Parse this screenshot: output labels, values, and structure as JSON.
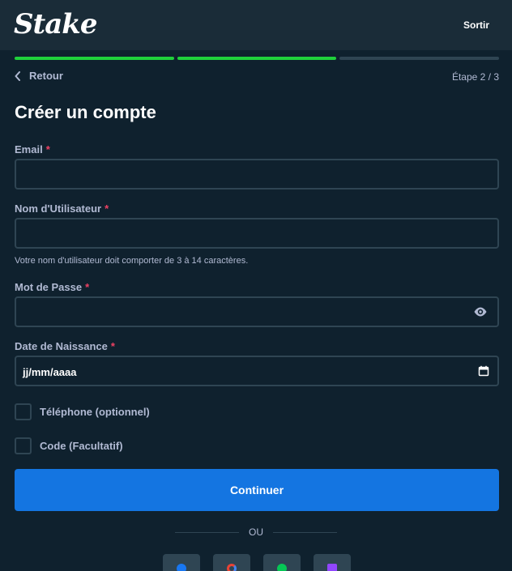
{
  "header": {
    "logo_text": "Stake",
    "exit_label": "Sortir"
  },
  "progress": {
    "total_steps": 3,
    "completed_steps": 2,
    "completed_color": "#1fd03b",
    "pending_color": "#2f4553"
  },
  "nav": {
    "back_label": "Retour",
    "step_text": "Étape 2 / 3"
  },
  "form": {
    "title": "Créer un compte",
    "required_mark": "*",
    "email_label": "Email",
    "email_value": "",
    "username_label": "Nom d'Utilisateur",
    "username_value": "",
    "username_hint": "Votre nom d'utilisateur doit comporter de 3 à 14 caractères.",
    "password_label": "Mot de Passe",
    "password_value": "",
    "dob_label": "Date de Naissance",
    "dob_placeholder": "jj/mm/aaaa",
    "phone_checkbox_label": "Téléphone (optionnel)",
    "code_checkbox_label": "Code (Facultatif)",
    "continue_label": "Continuer",
    "or_label": "OU"
  },
  "social": [
    {
      "name": "facebook-icon",
      "color": "#1877f2"
    },
    {
      "name": "google-icon",
      "color": "#ea4335"
    },
    {
      "name": "line-icon",
      "color": "#06c755"
    },
    {
      "name": "twitch-icon",
      "color": "#9146ff"
    }
  ],
  "colors": {
    "background": "#0f212e",
    "header": "#1a2c38",
    "accent_blue": "#1475e1",
    "required_red": "#ed4163",
    "muted_text": "#b1bad3"
  }
}
